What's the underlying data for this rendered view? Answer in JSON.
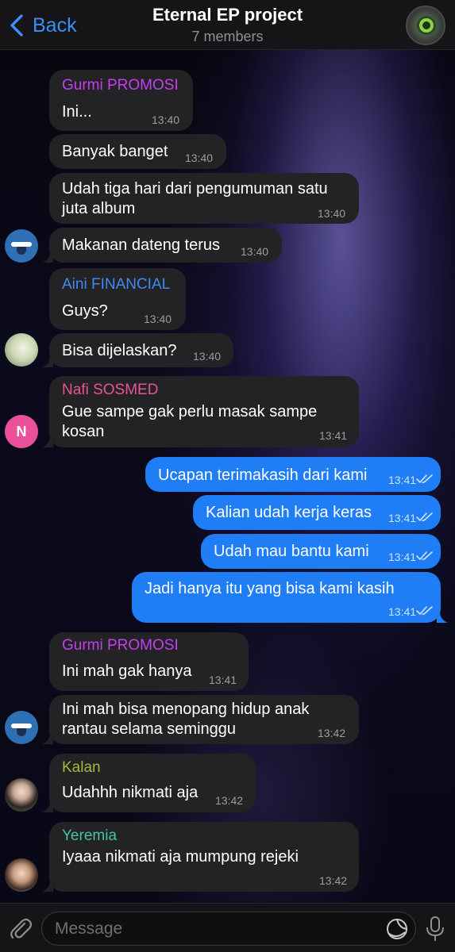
{
  "header": {
    "back_label": "Back",
    "title": "Eternal EP project",
    "subtitle": "7 members"
  },
  "messages": [
    {
      "sender": "Gurmi PROMOSI",
      "sender_color": "#c43ff0",
      "lines": [
        "Ini..."
      ],
      "time": "13:40"
    },
    {
      "lines": [
        "Banyak banget"
      ],
      "time": "13:40"
    },
    {
      "lines": [
        "Udah tiga hari dari pengumuman satu",
        "juta album"
      ],
      "time": "13:40"
    },
    {
      "lines": [
        "Makanan dateng terus"
      ],
      "time": "13:40"
    },
    {
      "sender": "Aini FINANCIAL",
      "sender_color": "#3f8af0",
      "lines": [
        "Guys?"
      ],
      "time": "13:40"
    },
    {
      "lines": [
        "Bisa dijelaskan?"
      ],
      "time": "13:40"
    },
    {
      "sender": "Nafi SOSMED",
      "sender_color": "#e9529a",
      "lines": [
        "Gue sampe gak perlu masak sampe",
        "kosan"
      ],
      "time": "13:41"
    },
    {
      "lines": [
        "Ucapan terimakasih dari kami"
      ],
      "time": "13:41",
      "outgoing": true
    },
    {
      "lines": [
        "Kalian udah kerja keras"
      ],
      "time": "13:41",
      "outgoing": true
    },
    {
      "lines": [
        "Udah mau bantu kami"
      ],
      "time": "13:41",
      "outgoing": true
    },
    {
      "lines": [
        "Jadi hanya itu yang bisa kami kasih"
      ],
      "time": "13:41",
      "outgoing": true
    },
    {
      "sender": "Gurmi PROMOSI",
      "sender_color": "#c43ff0",
      "lines": [
        "Ini mah gak hanya"
      ],
      "time": "13:41"
    },
    {
      "lines": [
        "Ini mah bisa menopang hidup anak",
        "rantau selama seminggu"
      ],
      "time": "13:42"
    },
    {
      "sender": "Kalan",
      "sender_color": "#a7b93a",
      "lines": [
        "Udahhh nikmati aja"
      ],
      "time": "13:42"
    },
    {
      "sender": "Yeremia",
      "sender_color": "#3fc6a0",
      "lines": [
        "Iyaaa nikmati aja mumpung rejeki"
      ],
      "time": "13:42"
    }
  ],
  "avatars": {
    "nafi_initial": "N"
  },
  "input": {
    "placeholder": "Message"
  },
  "icons": {
    "back": "chevron-left-icon",
    "attach": "paperclip-icon",
    "sticker": "sticker-icon",
    "mic": "microphone-icon"
  },
  "colors": {
    "accent": "#3a8ff7",
    "outgoing_bubble": "#1f7df5",
    "incoming_bubble": "#232326"
  }
}
